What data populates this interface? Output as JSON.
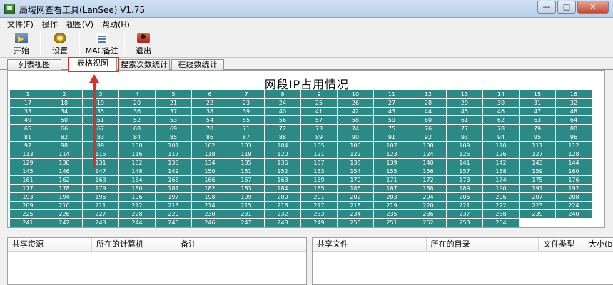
{
  "window": {
    "title": "局域网查看工具(LanSee) V1.75",
    "min": "—",
    "max": "□",
    "close": "✕"
  },
  "menu": [
    "文件(F)",
    "操作",
    "视图(V)",
    "帮助(H)"
  ],
  "toolbar": {
    "start": "开始",
    "settings": "设置",
    "mac_note": "MAC备注",
    "exit": "退出"
  },
  "tabs": [
    "列表视图",
    "表格视图",
    "搜索次数统计",
    "在线数统计"
  ],
  "active_tab": 1,
  "grid": {
    "title": "网段IP占用情况",
    "first": 1,
    "last": 254,
    "columns": 16,
    "cell_color": "#2b8a86"
  },
  "left_table": {
    "headers": [
      "共享资源",
      "所在的计算机",
      "备注"
    ]
  },
  "right_table": {
    "headers": [
      "共享文件",
      "所在的目录",
      "文件类型",
      "大小(b"
    ]
  },
  "colors": {
    "annotation": "#d9312a",
    "cell": "#2b8a86"
  }
}
